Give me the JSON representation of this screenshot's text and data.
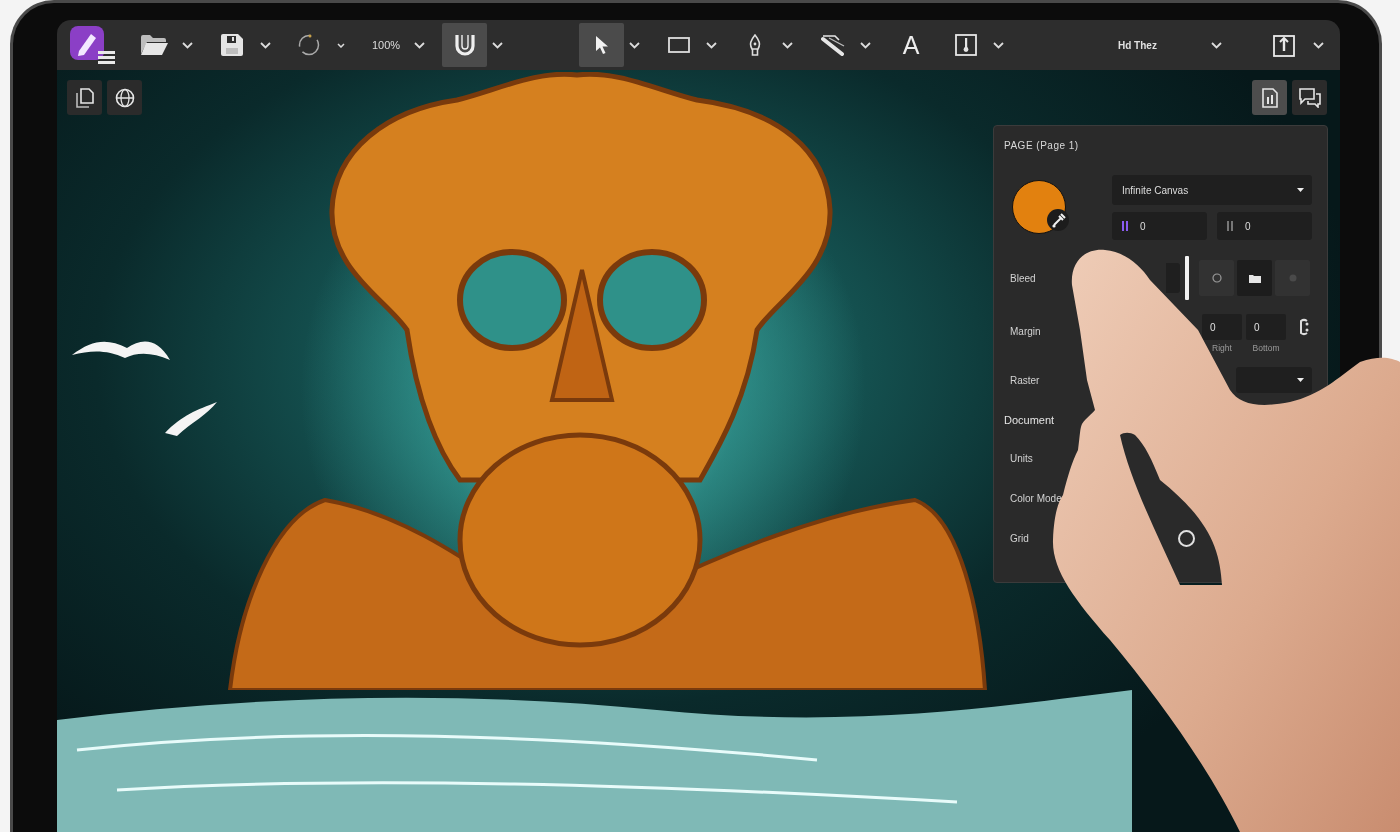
{
  "toolbar": {
    "zoom": "100%",
    "snapping": {
      "on": true
    },
    "tools": [
      {
        "selected": true
      },
      {
        "selected": false
      },
      {
        "selected": false
      },
      {
        "selected": false
      },
      {
        "selected": false,
        "glyph": "A"
      },
      {
        "selected": false
      }
    ],
    "persona": "Hd Thez"
  },
  "canvas": {
    "studio_tabs": [
      {
        "selected": true
      },
      {
        "selected": false
      }
    ]
  },
  "panel": {
    "title": "PAGE (Page 1)",
    "canvas_type": "Infinite Canvas",
    "size_fields": [
      {
        "value": "0",
        "active": true
      },
      {
        "value": "0",
        "active": false
      }
    ],
    "rows": [
      {
        "kind": "bleed",
        "label": "Bleed",
        "options": [
          {
            "selected": false
          },
          {
            "selected": true
          },
          {
            "selected": false
          }
        ]
      },
      {
        "kind": "margin",
        "label": "Margin",
        "fields": [
          {
            "value": "0",
            "caption": "Right"
          },
          {
            "value": "0",
            "caption": "Bottom"
          }
        ]
      },
      {
        "kind": "dropdown",
        "label": "Raster"
      }
    ],
    "document": {
      "heading": "Document",
      "rows": [
        {
          "kind": "plain",
          "label": "Units"
        },
        {
          "kind": "plain",
          "label": "Color Mode"
        },
        {
          "kind": "radio",
          "label": "Grid",
          "checked": false
        }
      ]
    }
  }
}
